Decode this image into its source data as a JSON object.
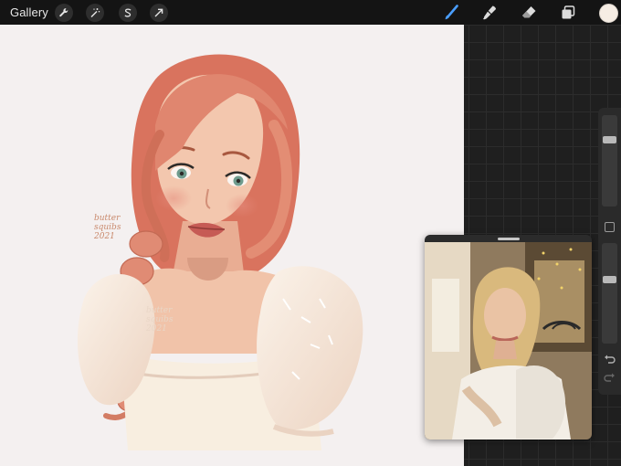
{
  "app": {
    "name": "Procreate"
  },
  "toolbar": {
    "gallery_label": "Gallery",
    "left_tools": [
      {
        "icon": "wrench-icon",
        "name": "actions"
      },
      {
        "icon": "magic-wand-icon",
        "name": "adjustments"
      },
      {
        "icon": "selection-s-icon",
        "name": "selection"
      },
      {
        "icon": "transform-arrow-icon",
        "name": "transform"
      }
    ],
    "right_tools": [
      {
        "icon": "brush-icon",
        "name": "paint",
        "active": true
      },
      {
        "icon": "smudge-icon",
        "name": "smudge"
      },
      {
        "icon": "eraser-icon",
        "name": "eraser"
      },
      {
        "icon": "layers-icon",
        "name": "layers"
      }
    ],
    "current_color": "#f6ede4"
  },
  "sidebar": {
    "brush_size_level": 0.25,
    "opacity_level": 0.35,
    "icons": [
      "modify-button",
      "undo-icon",
      "redo-icon"
    ]
  },
  "artwork": {
    "signature_top": "butter\nsquibs\n2021",
    "signature_chest": "butter\nsquibs\n2021",
    "palette": {
      "hair": "#e0866f",
      "skin": "#f3c7ae",
      "blouse": "#f8eee0",
      "lips": "#c65b55",
      "eyes": "#6f9c8e"
    }
  },
  "reference": {
    "label": "reference-window"
  },
  "colors": {
    "topbar": "#141414",
    "canvas": "#f4f0f0",
    "grid": "#2c2c2c",
    "active_brush": "#4a9eff"
  }
}
